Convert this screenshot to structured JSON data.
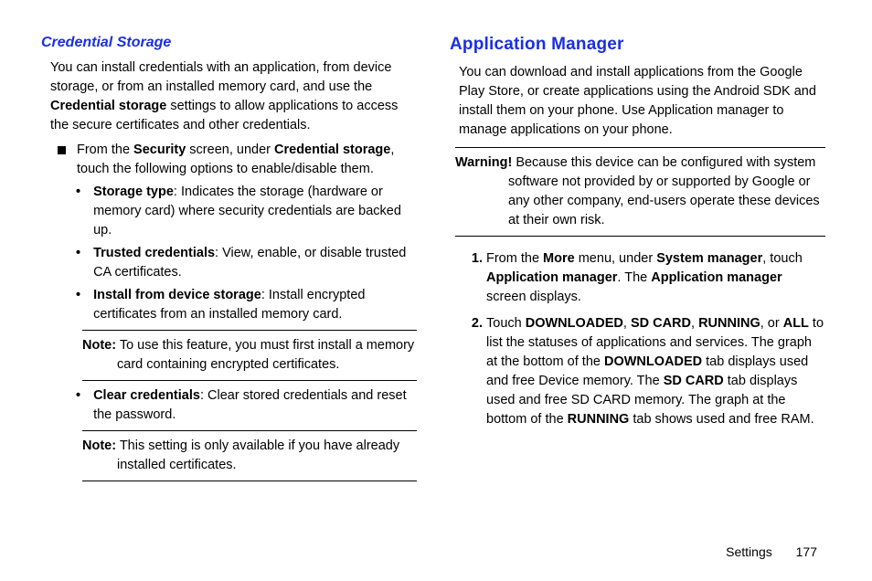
{
  "left": {
    "heading": "Credential Storage",
    "intro_pre": "You can install credentials with an application, from device storage, or from an installed memory card, and use the ",
    "intro_bold": "Credential storage",
    "intro_post": " settings to allow applications to access the secure certificates and other credentials.",
    "square_pre": "From the ",
    "square_b1": "Security",
    "square_mid": " screen, under ",
    "square_b2": "Credential storage",
    "square_post": ", touch the following options to enable/disable them.",
    "b1_bold": "Storage type",
    "b1_text": ": Indicates the storage (hardware or memory card) where security credentials are backed up.",
    "b2_bold": "Trusted credentials",
    "b2_text": ": View, enable, or disable trusted CA certificates.",
    "b3_bold": "Install from device storage",
    "b3_text": ": Install encrypted certificates from an installed memory card.",
    "note1_bold": "Note:",
    "note1_text": " To use this feature, you must first install a memory card containing encrypted certificates.",
    "b4_bold": "Clear credentials",
    "b4_text": ": Clear stored credentials and reset the password.",
    "note2_bold": "Note:",
    "note2_text": " This setting is only available if you have already installed certificates."
  },
  "right": {
    "heading": "Application Manager",
    "intro": "You can download and install applications from the Google Play Store, or create applications using the Android SDK and install them on your phone. Use Application manager to manage applications on your phone.",
    "warn_bold": "Warning!",
    "warn_text": " Because this device can be configured with system software not provided by or supported by Google or any other company, end-users operate these devices at their own risk.",
    "s1_a": "From the ",
    "s1_b1": "More",
    "s1_b": " menu, under ",
    "s1_b2": "System manager",
    "s1_c": ", touch ",
    "s1_b3": "Application manager",
    "s1_d": ". The ",
    "s1_b4": "Application manager",
    "s1_e": " screen displays.",
    "s2_a": "Touch ",
    "s2_b1": "DOWNLOADED",
    "s2_b": ", ",
    "s2_b2": "SD CARD",
    "s2_c": ", ",
    "s2_b3": "RUNNING",
    "s2_d": ", or ",
    "s2_b4": "ALL",
    "s2_e": " to list the statuses of applications and services. The graph at the bottom of the ",
    "s2_b5": "DOWNLOADED",
    "s2_f": " tab displays used and free Device memory. The ",
    "s2_b6": "SD CARD",
    "s2_g": " tab displays used and free SD CARD memory. The graph at the bottom of the ",
    "s2_b7": "RUNNING",
    "s2_h": " tab shows used and free RAM."
  },
  "footer": {
    "section": "Settings",
    "page": "177"
  }
}
